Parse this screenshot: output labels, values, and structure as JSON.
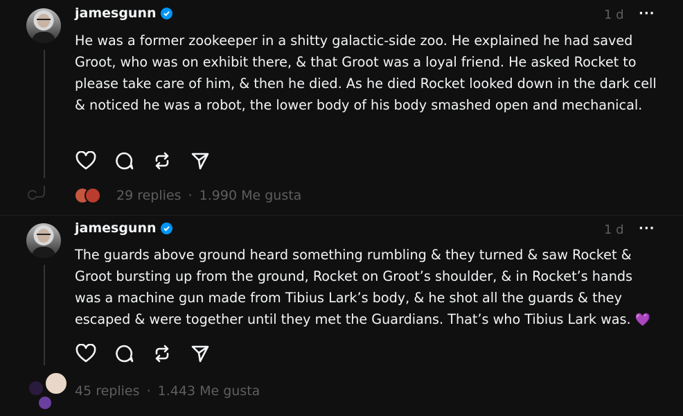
{
  "posts": [
    {
      "username": "jamesgunn",
      "time": "1 d",
      "more": "···",
      "text": "He was a former zookeeper in a shitty galactic-side zoo. He explained he had saved Groot, who was on exhibit there, & that Groot was a loyal friend. He asked Rocket to please take care of him, & then he died. As he died Rocket looked down in the dark cell & noticed he was a robot, the lower body of his body smashed open and mechanical.",
      "replies": "29 replies",
      "separator": "·",
      "likes": "1.990 Me gusta"
    },
    {
      "username": "jamesgunn",
      "time": "1 d",
      "more": "···",
      "text": "The guards above ground heard something rumbling & they turned & saw Rocket & Groot bursting up from the ground, Rocket on Groot’s shoulder, & in Rocket’s hands was a machine gun made from Tibius Lark’s body, & he shot all the guards & they escaped & were together until they met the Guardians. That’s who Tibius Lark was.",
      "emoji": "💜",
      "replies": "45 replies",
      "separator": "·",
      "likes": "1.443 Me gusta"
    }
  ],
  "icons": {
    "verified": "verified-badge-icon",
    "like": "heart-icon",
    "reply": "comment-bubble-icon",
    "repost": "repost-icon",
    "share": "send-icon"
  },
  "colors": {
    "background": "#101010",
    "text": "#f3f5f7",
    "muted": "#5e5e5e",
    "verified": "#0095f6",
    "emoji_heart": "#8f5ae8"
  }
}
